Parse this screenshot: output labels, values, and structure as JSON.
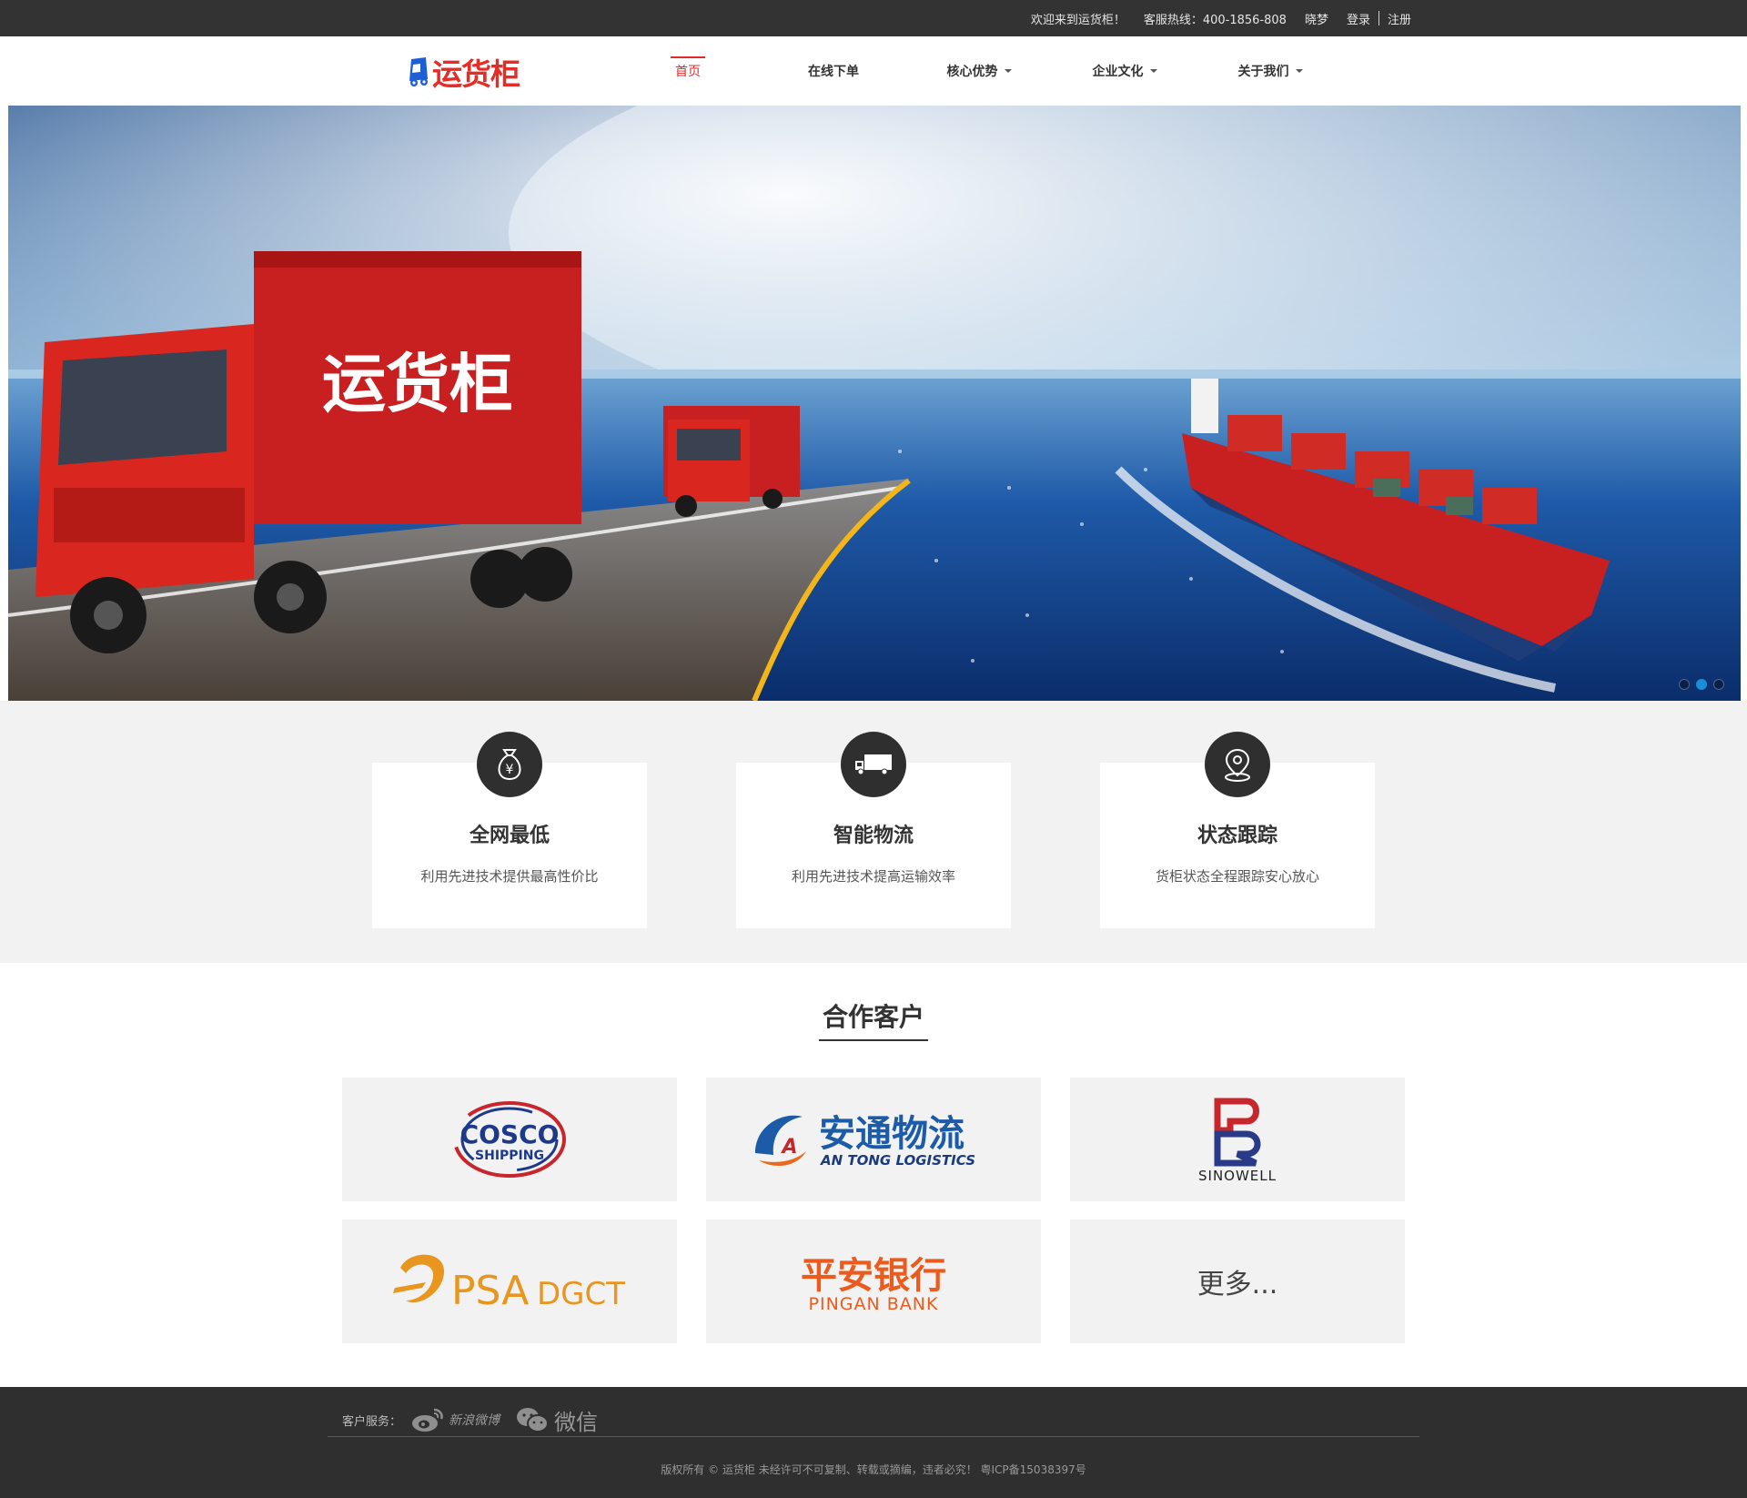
{
  "topbar": {
    "welcome": "欢迎来到运货柜！",
    "hotline": "客服热线：400-1856-808",
    "username": "晓梦",
    "login": "登录",
    "register": "注册"
  },
  "header": {
    "logo_text": "运货柜",
    "nav": [
      {
        "label": "首页",
        "active": true
      },
      {
        "label": "在线下单"
      },
      {
        "label": "核心优势"
      },
      {
        "label": "企业文化"
      },
      {
        "label": "关于我们"
      }
    ]
  },
  "banner": {
    "truck_text": "运货柜",
    "slide_count": 3,
    "active_slide": 2
  },
  "features": [
    {
      "icon": "money-bag-icon",
      "title": "全网最低",
      "desc": "利用先进技术提供最高性价比"
    },
    {
      "icon": "truck-icon",
      "title": "智能物流",
      "desc": "利用先进技术提高运输效率"
    },
    {
      "icon": "location-pin-icon",
      "title": "状态跟踪",
      "desc": "货柜状态全程跟踪安心放心"
    }
  ],
  "partners": {
    "title": "合作客户",
    "items": [
      {
        "name": "COSCO SHIPPING",
        "line1": "COSCO",
        "line2": "SHIPPING"
      },
      {
        "name": "安通物流 AN TONG LOGISTICS",
        "line1": "安通物流",
        "line2": "AN TONG LOGISTICS"
      },
      {
        "name": "SINOWELL",
        "line1": "SINOWELL"
      },
      {
        "name": "PSA DGCT",
        "line1": "PSA",
        "line2": "DGCT"
      },
      {
        "name": "平安银行 PINGAN BANK",
        "line1": "平安银行",
        "line2": "PINGAN BANK"
      },
      {
        "name": "更多...",
        "line1": "更多..."
      }
    ]
  },
  "footer": {
    "service_label": "客户服务：",
    "weibo": "新浪微博",
    "wechat": "微信",
    "copyright": "版权所有 © 运货柜 未经许可不可复制、转载或摘编，违者必究！ 粤ICP备15038397号"
  },
  "colors": {
    "brand_red": "#e52d27",
    "topbar_bg": "#333333",
    "footer_bg": "#2f2f2f",
    "feature_bg": "#f2f2f2",
    "slide_dot_active": "#1a8fd8"
  }
}
